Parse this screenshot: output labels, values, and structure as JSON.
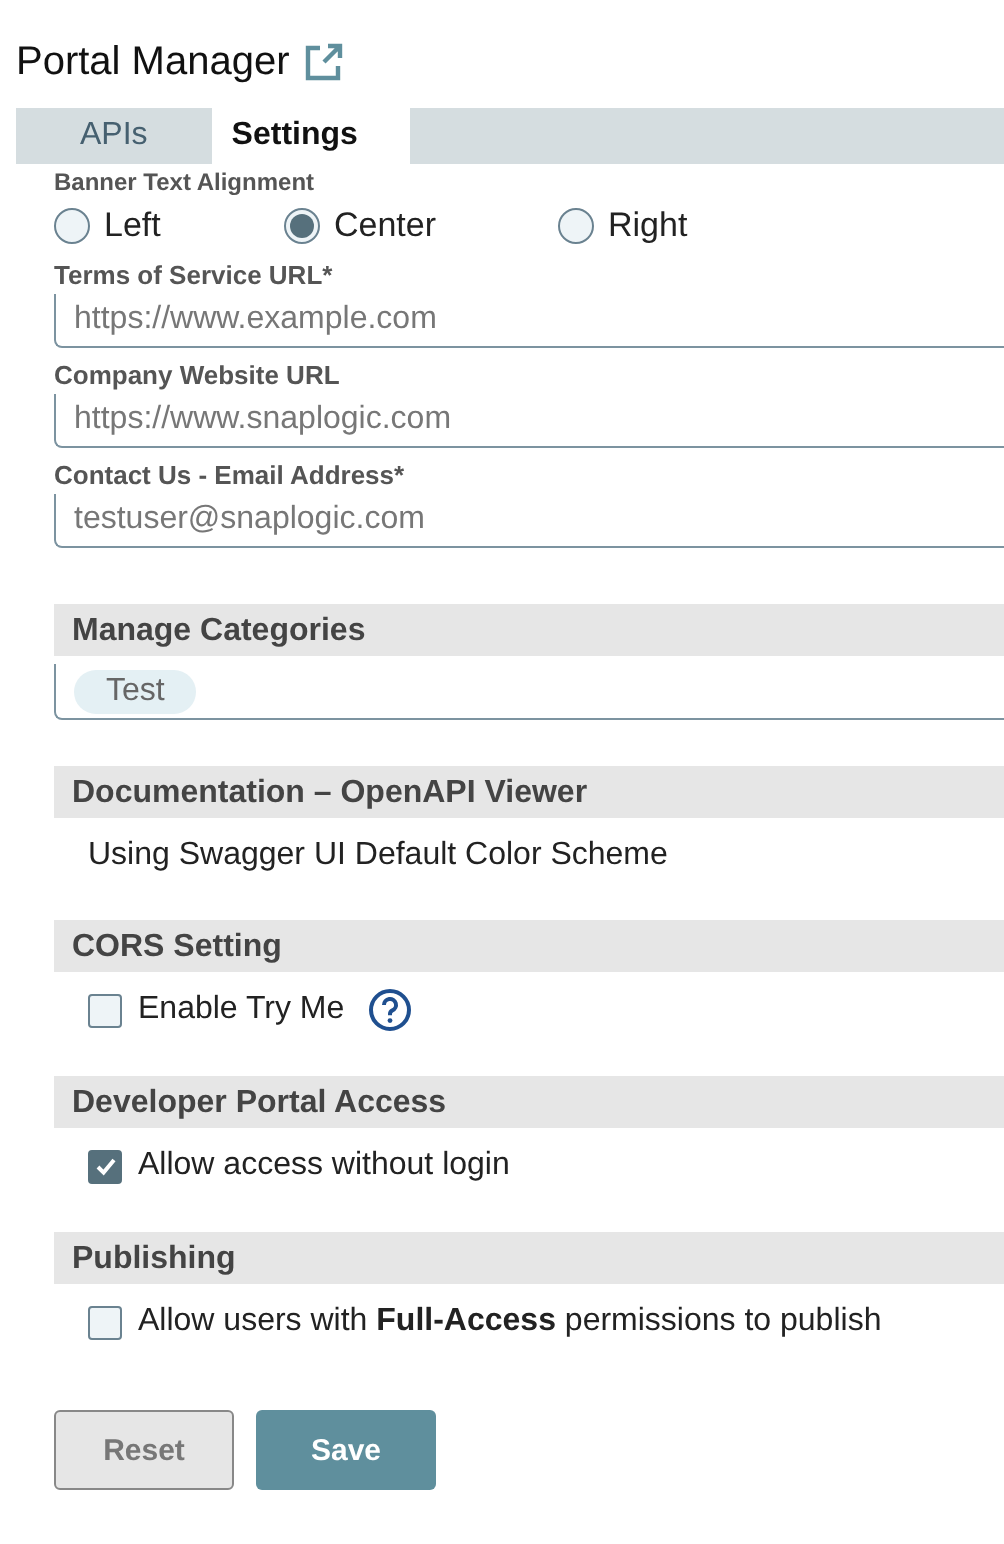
{
  "title": "Portal Manager",
  "tabs": [
    {
      "label": "APIs",
      "selected": false
    },
    {
      "label": "Settings",
      "selected": true
    }
  ],
  "banner_alignment": {
    "label": "Banner Text Alignment",
    "options": [
      {
        "label": "Left",
        "selected": false
      },
      {
        "label": "Center",
        "selected": true
      },
      {
        "label": "Right",
        "selected": false
      }
    ]
  },
  "fields": [
    {
      "label": "Terms of Service URL*",
      "placeholder": "https://www.example.com"
    },
    {
      "label": "Company Website URL",
      "value": "https://www.snaplogic.com"
    },
    {
      "label": "Contact Us - Email Address*",
      "value": "testuser@snaplogic.com"
    }
  ],
  "sections": [
    {
      "title": "Manage Categories",
      "kind": "chips",
      "chips": [
        "Test"
      ]
    },
    {
      "title": "Documentation – OpenAPI Viewer",
      "kind": "text",
      "text": "Using Swagger UI Default Color Scheme"
    },
    {
      "title": "CORS Setting",
      "kind": "checkbox",
      "label": "Enable Try Me",
      "checked": false,
      "has_help": true
    },
    {
      "title": "Developer Portal Access",
      "kind": "checkbox",
      "label": "Allow access without login",
      "checked": true
    },
    {
      "title": "Publishing",
      "kind": "checkbox",
      "label": "Allow users with **Full-Access** permissions to publish",
      "checked": false
    }
  ],
  "buttons": [
    {
      "label": "Reset",
      "kind": "secondary"
    },
    {
      "label": "Save",
      "kind": "primary"
    }
  ]
}
